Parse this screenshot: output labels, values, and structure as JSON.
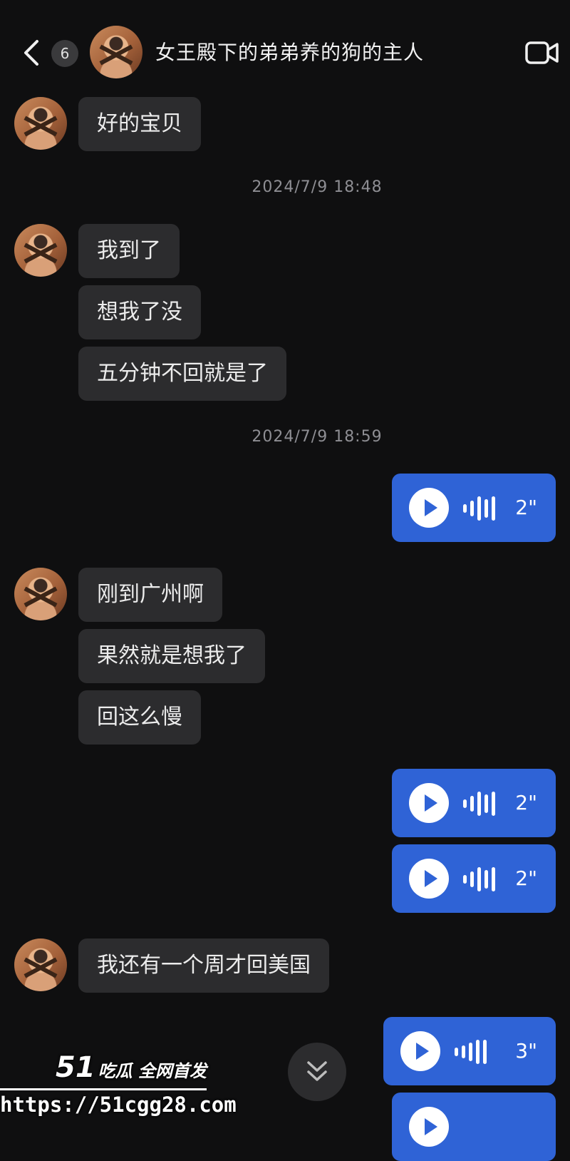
{
  "header": {
    "unread_count": "6",
    "title": "女王殿下的弟弟养的狗的主人"
  },
  "messages": {
    "m1": "好的宝贝",
    "t1": "2024/7/9 18:48",
    "m2": "我到了",
    "m3": "想我了没",
    "m4": "五分钟不回就是了",
    "t2": "2024/7/9 18:59",
    "v1": "2\"",
    "m5": "刚到广州啊",
    "m6": "果然就是想我了",
    "m7": "回这么慢",
    "v2": "2\"",
    "v3": "2\"",
    "m8": "我还有一个周才回美国",
    "v4": "3\""
  },
  "watermark": {
    "brand_num": "51",
    "brand_text": "吃瓜 全网首发",
    "url": "https://51cgg28.com"
  },
  "colors": {
    "background": "#0f0f10",
    "incoming_bubble": "#2c2c2e",
    "voice_bubble": "#2f63d6"
  },
  "icons": [
    "back-chevron-icon",
    "video-call-icon",
    "play-icon",
    "waveform-icon",
    "double-chevron-down-icon"
  ]
}
